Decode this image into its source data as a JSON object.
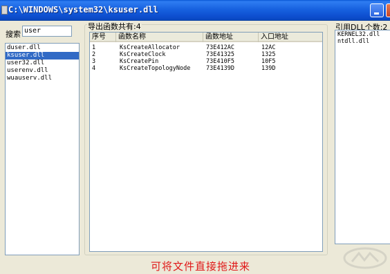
{
  "window": {
    "title": "C:\\WINDOWS\\system32\\ksuser.dll"
  },
  "search": {
    "label": "搜索",
    "value": "user"
  },
  "dll_list": {
    "items": [
      "duser.dll",
      "ksuser.dll",
      "user32.dll",
      "userenv.dll",
      "wuauserv.dll"
    ],
    "selected_index": 1
  },
  "exports": {
    "group_label": "导出函数共有:4",
    "columns": [
      "序号",
      "函数名称",
      "函数地址",
      "入口地址"
    ],
    "rows": [
      [
        "1",
        "KsCreateAllocator",
        "73E412AC",
        "12AC"
      ],
      [
        "2",
        "KsCreateClock",
        "73E41325",
        "1325"
      ],
      [
        "3",
        "KsCreatePin",
        "73E410F5",
        "10F5"
      ],
      [
        "4",
        "KsCreateTopologyNode",
        "73E4139D",
        "139D"
      ]
    ]
  },
  "references": {
    "label": "引用DLL个数:2",
    "items": [
      "KERNEL32.dll",
      "ntdll.dll"
    ]
  },
  "hint": "可将文件直接拖进来",
  "colors": {
    "titlebar": "#0a4fd0",
    "selection": "#316ac5",
    "hint_text": "#e01818",
    "window_bg": "#ece9d8"
  }
}
